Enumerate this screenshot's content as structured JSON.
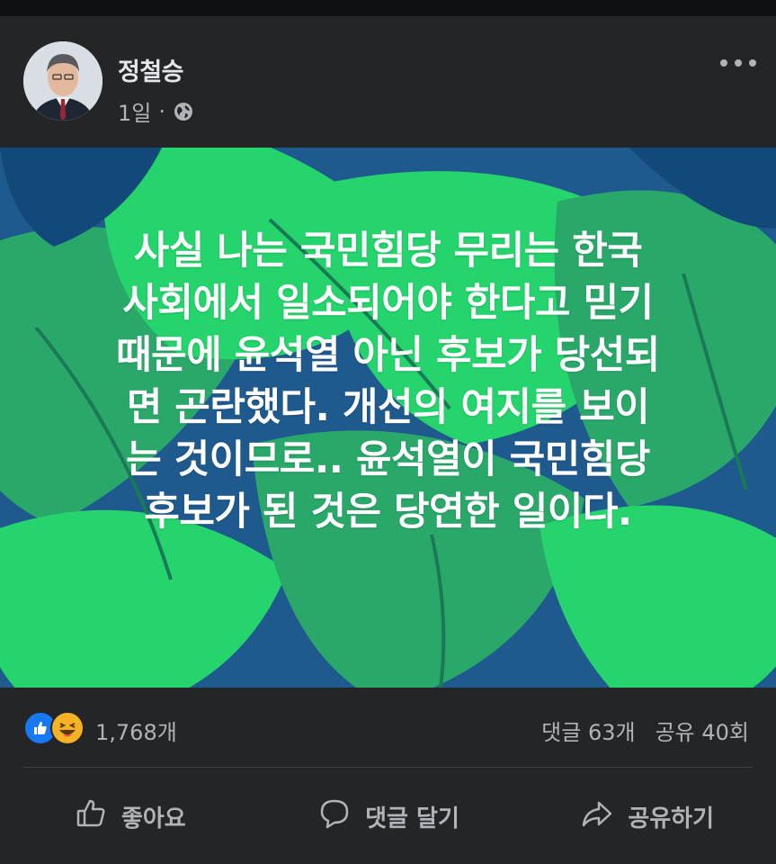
{
  "post": {
    "author": "정철승",
    "time": "1일",
    "separator": "·",
    "audience_icon": "globe-icon",
    "more_icon": "more-options-icon",
    "text_lines": [
      "사실 나는 국민힘당 무리는 한국",
      "사회에서 일소되어야 한다고 믿기",
      "때문에 윤석열 아닌 후보가 당선되",
      "면 곤란했다. 개선의 여지를 보이",
      "는 것이므로.. 윤석열이 국민힘당",
      "후보가 된 것은 당연한 일이다."
    ],
    "background_colors": [
      "#1f5a8f",
      "#25d46c",
      "#2aa86a",
      "#13497a"
    ]
  },
  "stats": {
    "reactions": [
      "like-icon",
      "haha-icon"
    ],
    "reaction_count": "1,768개",
    "comments": "댓글 63개",
    "shares": "공유 40회"
  },
  "actions": {
    "like": "좋아요",
    "comment": "댓글 달기",
    "share": "공유하기"
  }
}
